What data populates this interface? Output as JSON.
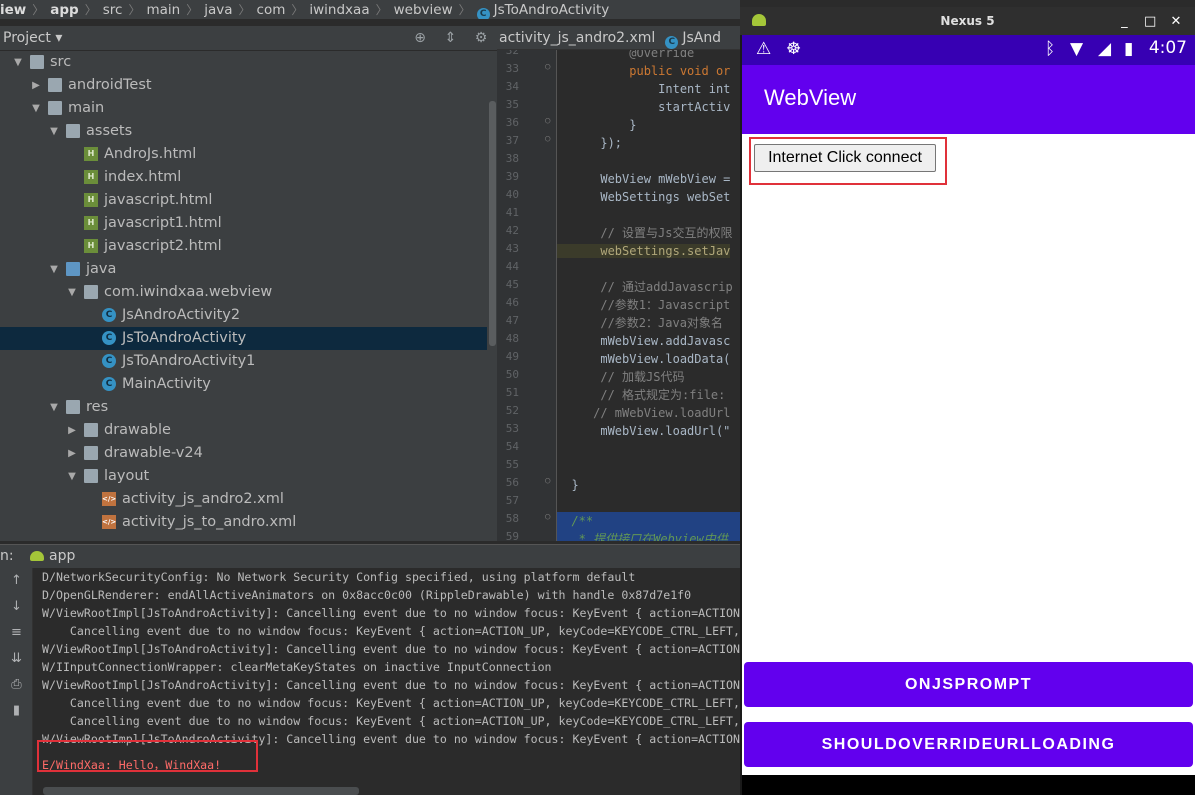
{
  "breadcrumb": {
    "items": [
      "iew",
      "app",
      "src",
      "main",
      "java",
      "com",
      "iwindxaa",
      "webview",
      "JsToAndroActivity"
    ],
    "class_icon": "C"
  },
  "project": {
    "title": "Project ▾",
    "icons": [
      "target-icon",
      "collapse-icon",
      "gear-icon",
      "minimize-icon"
    ],
    "tree": [
      {
        "label": "src",
        "depth": 1,
        "arrow": "▼",
        "icon": "folder"
      },
      {
        "label": "androidTest",
        "depth": 2,
        "arrow": "▶",
        "icon": "folder"
      },
      {
        "label": "main",
        "depth": 2,
        "arrow": "▼",
        "icon": "folder"
      },
      {
        "label": "assets",
        "depth": 3,
        "arrow": "▼",
        "icon": "folder"
      },
      {
        "label": "AndroJs.html",
        "depth": 4,
        "arrow": "",
        "icon": "html"
      },
      {
        "label": "index.html",
        "depth": 4,
        "arrow": "",
        "icon": "html"
      },
      {
        "label": "javascript.html",
        "depth": 4,
        "arrow": "",
        "icon": "html"
      },
      {
        "label": "javascript1.html",
        "depth": 4,
        "arrow": "",
        "icon": "html"
      },
      {
        "label": "javascript2.html",
        "depth": 4,
        "arrow": "",
        "icon": "html"
      },
      {
        "label": "java",
        "depth": 3,
        "arrow": "▼",
        "icon": "folder-blue"
      },
      {
        "label": "com.iwindxaa.webview",
        "depth": 4,
        "arrow": "▼",
        "icon": "folder"
      },
      {
        "label": "JsAndroActivity2",
        "depth": 5,
        "arrow": "",
        "icon": "class"
      },
      {
        "label": "JsToAndroActivity",
        "depth": 5,
        "arrow": "",
        "icon": "class",
        "selected": true
      },
      {
        "label": "JsToAndroActivity1",
        "depth": 5,
        "arrow": "",
        "icon": "class"
      },
      {
        "label": "MainActivity",
        "depth": 5,
        "arrow": "",
        "icon": "class"
      },
      {
        "label": "res",
        "depth": 3,
        "arrow": "▼",
        "icon": "folder"
      },
      {
        "label": "drawable",
        "depth": 4,
        "arrow": "▶",
        "icon": "folder"
      },
      {
        "label": "drawable-v24",
        "depth": 4,
        "arrow": "▶",
        "icon": "folder"
      },
      {
        "label": "layout",
        "depth": 4,
        "arrow": "▼",
        "icon": "folder"
      },
      {
        "label": "activity_js_andro2.xml",
        "depth": 5,
        "arrow": "",
        "icon": "xml"
      },
      {
        "label": "activity_js_to_andro.xml",
        "depth": 5,
        "arrow": "",
        "icon": "xml"
      }
    ]
  },
  "editor": {
    "tabs": [
      {
        "label": "activity_js_andro2.xml",
        "active": false
      },
      {
        "label": "JsAnd",
        "active": true
      }
    ],
    "line_numbers": [
      "32",
      "33",
      "34",
      "35",
      "36",
      "37",
      "38",
      "39",
      "40",
      "41",
      "42",
      "43",
      "44",
      "45",
      "46",
      "47",
      "48",
      "49",
      "50",
      "51",
      "52",
      "53",
      "54",
      "55",
      "56",
      "57",
      "58",
      "59"
    ],
    "code": [
      {
        "text": "          @Override",
        "cls": "cm"
      },
      {
        "text": "          public void or",
        "cls": "kw"
      },
      {
        "text": "              Intent int",
        "cls": ""
      },
      {
        "text": "              startActiv",
        "cls": ""
      },
      {
        "text": "          }",
        "cls": ""
      },
      {
        "text": "      });",
        "cls": ""
      },
      {
        "text": "",
        "cls": ""
      },
      {
        "text": "      WebView mWebView =",
        "cls": ""
      },
      {
        "text": "      WebSettings webSet",
        "cls": ""
      },
      {
        "text": "",
        "cls": ""
      },
      {
        "text": "      // 设置与Js交互的权限",
        "cls": "cm"
      },
      {
        "text": "      webSettings.setJav",
        "cls": "hl"
      },
      {
        "text": "",
        "cls": ""
      },
      {
        "text": "      // 通过addJavascrip",
        "cls": "cm"
      },
      {
        "text": "      //参数1：Javascript",
        "cls": "cm"
      },
      {
        "text": "      //参数2：Java对象名",
        "cls": "cm"
      },
      {
        "text": "      mWebView.addJavasc",
        "cls": ""
      },
      {
        "text": "      mWebView.loadData(",
        "cls": ""
      },
      {
        "text": "      // 加载JS代码",
        "cls": "cm"
      },
      {
        "text": "      // 格式规定为:file:",
        "cls": "cm"
      },
      {
        "text": "     // mWebView.loadUrl",
        "cls": "cm"
      },
      {
        "text": "      mWebView.loadUrl(\"",
        "cls": ""
      },
      {
        "text": "",
        "cls": ""
      },
      {
        "text": "",
        "cls": ""
      },
      {
        "text": "  }",
        "cls": ""
      },
      {
        "text": "",
        "cls": ""
      },
      {
        "text": "  /**",
        "cls": "doc"
      },
      {
        "text": "   * 提供接口在Webview中供",
        "cls": "doc"
      }
    ]
  },
  "run": {
    "label": "n:",
    "tab": "app",
    "tools": [
      "↑",
      "↓",
      "≡",
      "⇊",
      "⎙",
      "🗑"
    ],
    "logs": [
      {
        "text": "D/NetworkSecurityConfig: No Network Security Config specified, using platform default",
        "err": false
      },
      {
        "text": "D/OpenGLRenderer: endAllActiveAnimators on 0x8acc0c00 (RippleDrawable) with handle 0x87d7e1f0",
        "err": false
      },
      {
        "text": "W/ViewRootImpl[JsToAndroActivity]: Cancelling event due to no window focus: KeyEvent { action=ACTION",
        "err": false
      },
      {
        "text": "    Cancelling event due to no window focus: KeyEvent { action=ACTION_UP, keyCode=KEYCODE_CTRL_LEFT,",
        "err": false
      },
      {
        "text": "W/ViewRootImpl[JsToAndroActivity]: Cancelling event due to no window focus: KeyEvent { action=ACTION",
        "err": false
      },
      {
        "text": "W/IInputConnectionWrapper: clearMetaKeyStates on inactive InputConnection",
        "err": false
      },
      {
        "text": "W/ViewRootImpl[JsToAndroActivity]: Cancelling event due to no window focus: KeyEvent { action=ACTION",
        "err": false
      },
      {
        "text": "    Cancelling event due to no window focus: KeyEvent { action=ACTION_UP, keyCode=KEYCODE_CTRL_LEFT,",
        "err": false
      },
      {
        "text": "    Cancelling event due to no window focus: KeyEvent { action=ACTION_UP, keyCode=KEYCODE_CTRL_LEFT,",
        "err": false
      },
      {
        "text": "W/ViewRootImpl[JsToAndroActivity]: Cancelling event due to no window focus: KeyEvent { action=ACTION",
        "err": false
      },
      {
        "text": "E/WindXaa: Hello，WindXaa!",
        "err": true
      }
    ]
  },
  "emulator": {
    "title": "Nexus 5",
    "controls": [
      "_",
      "□",
      "✕"
    ],
    "status": {
      "time": "4:07"
    },
    "app_title": "WebView",
    "web_button": "Internet Click connect",
    "buttons": [
      "ONJSPROMPT",
      "SHOULDOVERRIDEURLLOADING"
    ],
    "colors": {
      "status_bar": "#3700b3",
      "app_bar": "#6200ee",
      "highlight": "#e0313a"
    }
  }
}
